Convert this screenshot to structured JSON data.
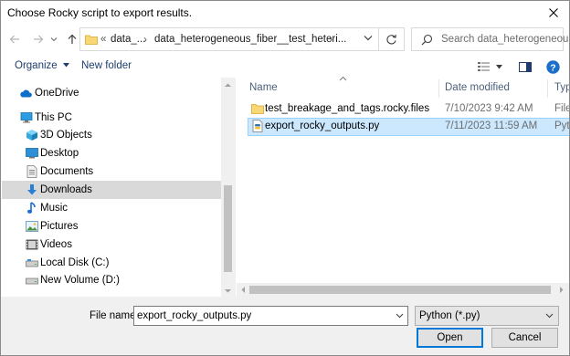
{
  "dialog": {
    "title": "Choose Rocky script to export results."
  },
  "address_bar": {
    "overflow": "«",
    "crumbs": [
      "data_...",
      "data_heterogeneous_fiber__test_heteri..."
    ]
  },
  "search": {
    "placeholder": "Search data_heterogeneous_..."
  },
  "toolbar": {
    "organize_label": "Organize",
    "new_folder_label": "New folder"
  },
  "navigation": {
    "items": [
      {
        "label": "OneDrive",
        "icon": "cloud-icon"
      },
      {
        "label": "This PC",
        "icon": "computer-icon"
      },
      {
        "label": "3D Objects",
        "icon": "cube-icon"
      },
      {
        "label": "Desktop",
        "icon": "desktop-icon"
      },
      {
        "label": "Documents",
        "icon": "document-icon"
      },
      {
        "label": "Downloads",
        "icon": "download-arrow-icon",
        "selected": true
      },
      {
        "label": "Music",
        "icon": "music-note-icon"
      },
      {
        "label": "Pictures",
        "icon": "picture-icon"
      },
      {
        "label": "Videos",
        "icon": "film-icon"
      },
      {
        "label": "Local Disk (C:)",
        "icon": "drive-icon"
      },
      {
        "label": "New Volume (D:)",
        "icon": "drive-icon"
      }
    ]
  },
  "file_list": {
    "columns": {
      "name": "Name",
      "date_modified": "Date modified",
      "type": "Type"
    },
    "rows": [
      {
        "name": "test_breakage_and_tags.rocky.files",
        "date_modified": "7/10/2023 9:42 AM",
        "type": "File",
        "icon": "folder-icon"
      },
      {
        "name": "export_rocky_outputs.py",
        "date_modified": "7/11/2023 11:59 AM",
        "type": "Pyth",
        "icon": "python-file-icon",
        "selected": true
      }
    ]
  },
  "footer": {
    "file_name_label": "File name:",
    "file_name_value": "export_rocky_outputs.py",
    "file_type_value": "Python (*.py)",
    "open_label": "Open",
    "cancel_label": "Cancel"
  },
  "colors": {
    "accent": "#0078d7",
    "selection": "#cce8ff",
    "nav_selected": "#d9d9d9"
  }
}
